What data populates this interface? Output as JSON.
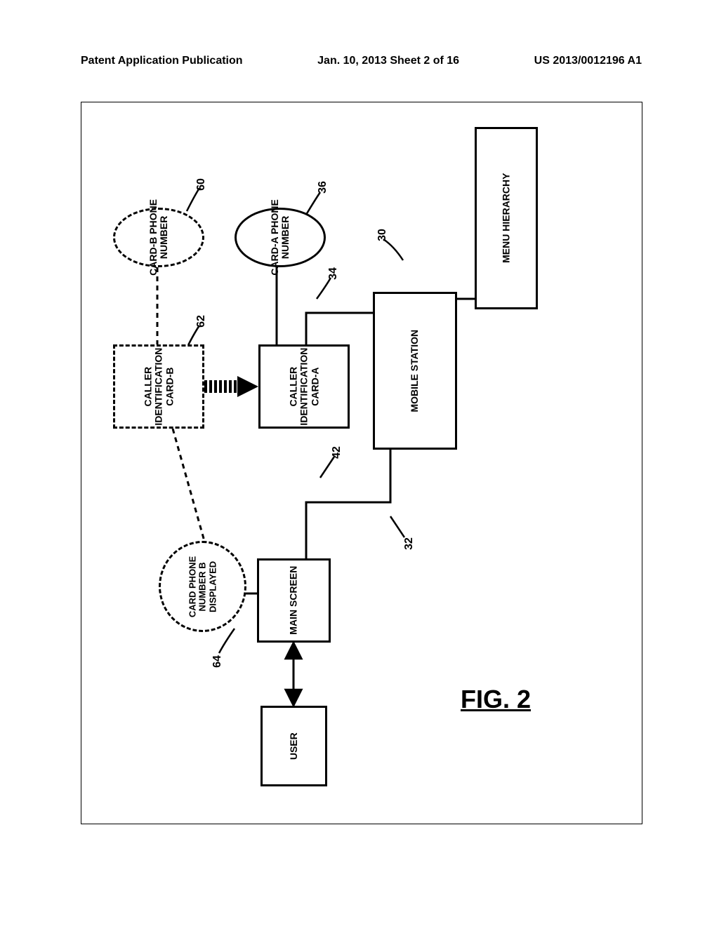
{
  "header": {
    "left": "Patent Application Publication",
    "center": "Jan. 10, 2013  Sheet 2 of 16",
    "right": "US 2013/0012196 A1"
  },
  "figure_label": "FIG. 2",
  "nodes": {
    "menu_hierarchy": "MENU HIERARCHY",
    "mobile_station": "MOBILE STATION",
    "caller_id_a_l1": "CALLER",
    "caller_id_a_l2": "IDENTIFICATION",
    "caller_id_a_l3": "CARD-A",
    "caller_id_b_l1": "CALLER",
    "caller_id_b_l2": "IDENTIFICATION",
    "caller_id_b_l3": "CARD-B",
    "card_a_phone_l1": "CARD-A PHONE",
    "card_a_phone_l2": "NUMBER",
    "card_b_phone_l1": "CARD-B PHONE",
    "card_b_phone_l2": "NUMBER",
    "main_screen": "MAIN SCREEN",
    "user": "USER",
    "displayed_l1": "CARD PHONE",
    "displayed_l2": "NUMBER B",
    "displayed_l3": "DISPLAYED"
  },
  "refs": {
    "r30": "30",
    "r32": "32",
    "r34": "34",
    "r36": "36",
    "r42": "42",
    "r60": "60",
    "r62": "62",
    "r64": "64"
  }
}
